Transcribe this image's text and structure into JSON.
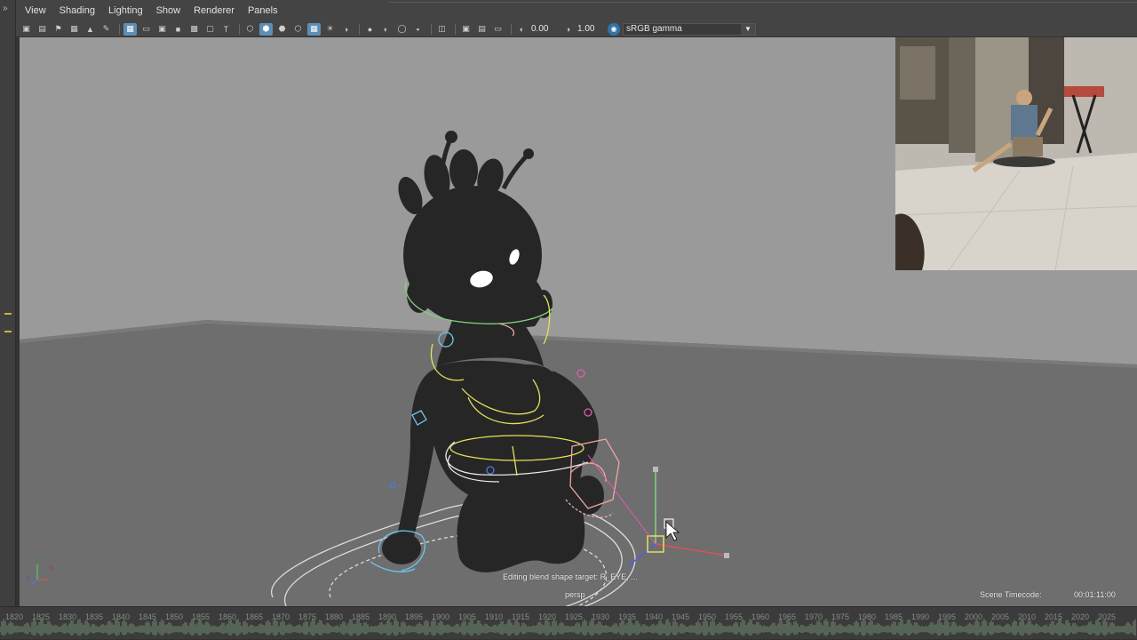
{
  "menu": [
    "View",
    "Shading",
    "Lighting",
    "Show",
    "Renderer",
    "Panels"
  ],
  "toolbar": {
    "exposure_value": "0.00",
    "gamma_value": "1.00",
    "color_space": "sRGB gamma"
  },
  "viewport": {
    "status_message": "Editing blend shape target: R_EYE, ...",
    "camera_name": "persp",
    "timecode_label": "Scene Timecode:",
    "timecode_value": "00:01:11:00",
    "axis_labels": {
      "x": "x",
      "y": "y",
      "z": "z"
    }
  },
  "timeline": {
    "frames": [
      "1820",
      "1825",
      "1830",
      "1835",
      "1840",
      "1845",
      "1850",
      "1855",
      "1860",
      "1865",
      "1870",
      "1875",
      "1880",
      "1885",
      "1890",
      "1895",
      "1900",
      "1905",
      "1910",
      "1915",
      "1920",
      "1925",
      "1930",
      "1935",
      "1940",
      "1945",
      "1950",
      "1955",
      "1960",
      "1965",
      "1970",
      "1975",
      "1980",
      "1985",
      "1990",
      "1995",
      "2000",
      "2005",
      "2010",
      "2015",
      "2020",
      "2025"
    ]
  },
  "colors": {
    "ui_background": "#444444",
    "viewport_wall": "#9a9a9a",
    "viewport_floor": "#6f6f6f",
    "active_icon": "#5d8fb6",
    "waveform": "#7fa37f",
    "controller_yellow": "#e4e25a",
    "controller_blue": "#6ec6ef",
    "controller_pink": "#f1a6a6"
  },
  "icons": [
    "camera-icon",
    "grid-icon",
    "wireframe-icon",
    "smooth-shade-icon",
    "texture-icon",
    "light-icon",
    "xray-icon",
    "isolate-icon",
    "exposure-icon",
    "gamma-icon",
    "colorspace-icon"
  ]
}
